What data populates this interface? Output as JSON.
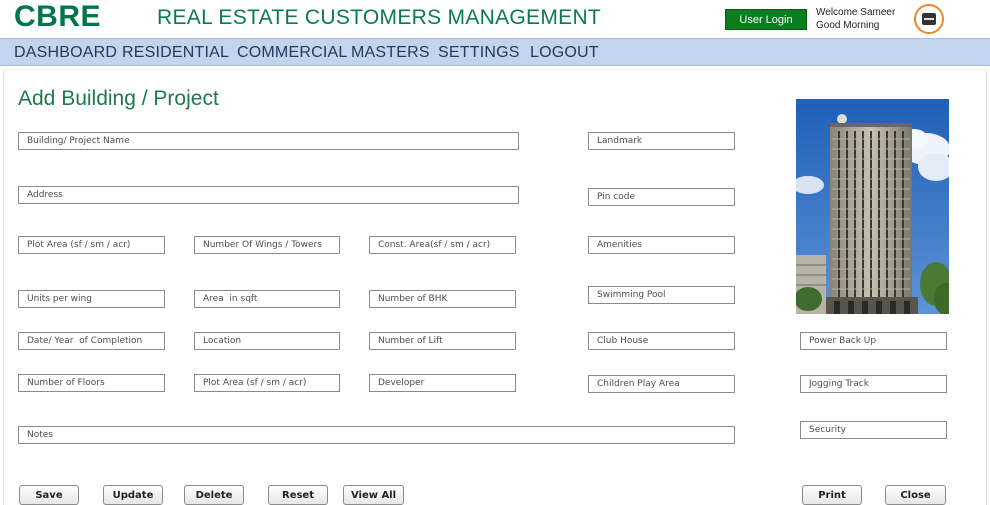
{
  "header": {
    "logo": "CBRE",
    "app_title": "REAL ESTATE CUSTOMERS MANAGEMENT",
    "login_label": "User Login",
    "welcome_line1": "Welcome Sameer",
    "welcome_line2": "Good Morning",
    "avatar_icon": "monitor-icon"
  },
  "nav": {
    "items": [
      "DASHBOARD",
      "RESIDENTIAL",
      "COMMERCIAL",
      "MASTERS",
      "SETTINGS",
      "LOGOUT"
    ]
  },
  "form": {
    "title": "Add Building / Project",
    "fields": {
      "building_name": "Building/ Project Name",
      "address": "Address",
      "plot_area": "Plot Area (sf / sm / acr)",
      "wings_towers": "Number Of Wings / Towers",
      "const_area": "Const. Area(sf / sm / acr)",
      "units_per_wing": "Units per wing",
      "area_sqft": "Area  in sqft",
      "bhk": "Number of BHK",
      "completion": "Date/ Year  of Completion",
      "location": "Location",
      "lift": "Number of Lift",
      "floors": "Number of Floors",
      "plot_area_2": "Plot Area (sf / sm / acr)",
      "developer": "Developer",
      "notes": "Notes",
      "landmark": "Landmark",
      "pincode": "Pin code",
      "amenities": "Amenities",
      "swimming_pool": "Swimming Pool",
      "club_house": "Club House",
      "children_play": "Children Play Area",
      "power_backup": "Power Back Up",
      "jogging_track": "Jogging Track",
      "security": "Security"
    }
  },
  "buttons": {
    "save": "Save",
    "update": "Update",
    "delete": "Delete",
    "reset": "Reset",
    "view_all": "View All",
    "print": "Print",
    "close": "Close"
  },
  "colors": {
    "brand": "#00774a",
    "nav_bg": "#c3d5ee",
    "login_bg": "#0a7d1d"
  }
}
